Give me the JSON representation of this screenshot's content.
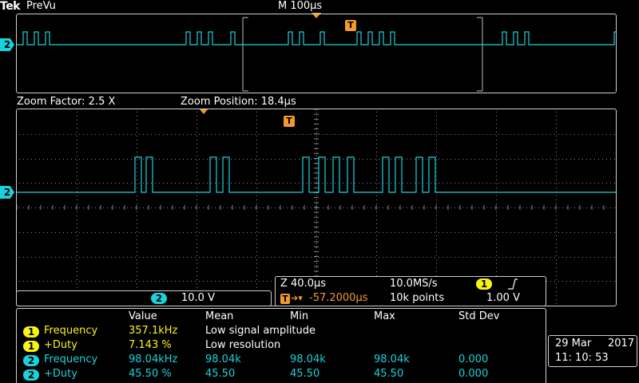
{
  "header": {
    "brand": "Tek",
    "mode": "PreVu",
    "timebase": "M 100µs"
  },
  "overview": {
    "channel_tag": "2"
  },
  "zoom": {
    "factor_label": "Zoom Factor: 2.5 X",
    "position_label": "Zoom Position: 18.4µs",
    "channel_tag": "2",
    "trigger_marker": "T"
  },
  "scale_box": {
    "channel": "2",
    "volts_per_div": "10.0 V"
  },
  "acq_box": {
    "zoom_timebase": "Z 40.0µs",
    "sample_rate": "10.0MS/s",
    "trigger_channel": "1",
    "trigger_slope_icon": "rising-edge-icon",
    "trigger_marker": "T",
    "trigger_position": "-57.2000µs",
    "record_length": "10k points",
    "trigger_level": "1.00 V"
  },
  "measurements": {
    "headers": [
      "Value",
      "Mean",
      "Min",
      "Max",
      "Std Dev"
    ],
    "rows": [
      {
        "channel": "1",
        "name": "Frequency",
        "value": "357.1kHz",
        "mean": "Low signal amplitude",
        "min": "",
        "max": "",
        "std": ""
      },
      {
        "channel": "1",
        "name": "+Duty",
        "value": "7.143 %",
        "mean": "Low resolution",
        "min": "",
        "max": "",
        "std": ""
      },
      {
        "channel": "2",
        "name": "Frequency",
        "value": "98.04kHz",
        "mean": "98.04k",
        "min": "98.04k",
        "max": "98.04k",
        "std": "0.000"
      },
      {
        "channel": "2",
        "name": "+Duty",
        "value": "45.50 %",
        "mean": "45.50",
        "min": "45.50",
        "max": "45.50",
        "std": "0.000"
      }
    ]
  },
  "datetime": {
    "date": "29 Mar",
    "year": "2017",
    "time": "11: 10: 53"
  },
  "colors": {
    "channel1": "#f7f31a",
    "channel2": "#19d3dc",
    "trigger": "#f29a2e",
    "trace": "#19d3dc"
  }
}
